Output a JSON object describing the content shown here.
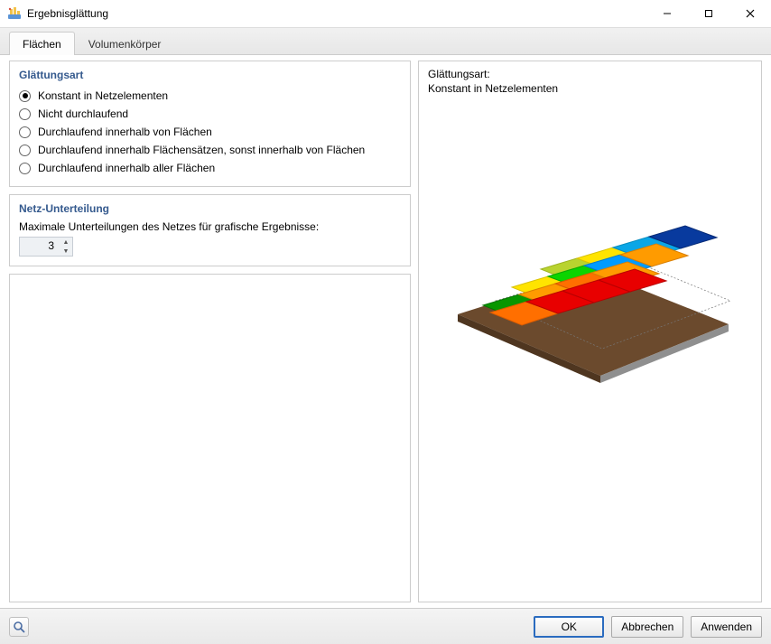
{
  "window": {
    "title": "Ergebnisglättung"
  },
  "tabs": {
    "t0": "Flächen",
    "t1": "Volumenkörper",
    "active": 0
  },
  "smoothing": {
    "heading": "Glättungsart",
    "options": {
      "o0": "Konstant in Netzelementen",
      "o1": "Nicht durchlaufend",
      "o2": "Durchlaufend innerhalb von Flächen",
      "o3": "Durchlaufend innerhalb Flächensätzen, sonst innerhalb von Flächen",
      "o4": "Durchlaufend innerhalb aller Flächen"
    },
    "selected": 0
  },
  "mesh": {
    "heading": "Netz-Unterteilung",
    "label": "Maximale Unterteilungen des Netzes für grafische Ergebnisse:",
    "value": "3"
  },
  "preview": {
    "label_line1": "Glättungsart:",
    "label_line2": "Konstant in Netzelementen"
  },
  "footer": {
    "ok": "OK",
    "cancel": "Abbrechen",
    "apply": "Anwenden"
  }
}
